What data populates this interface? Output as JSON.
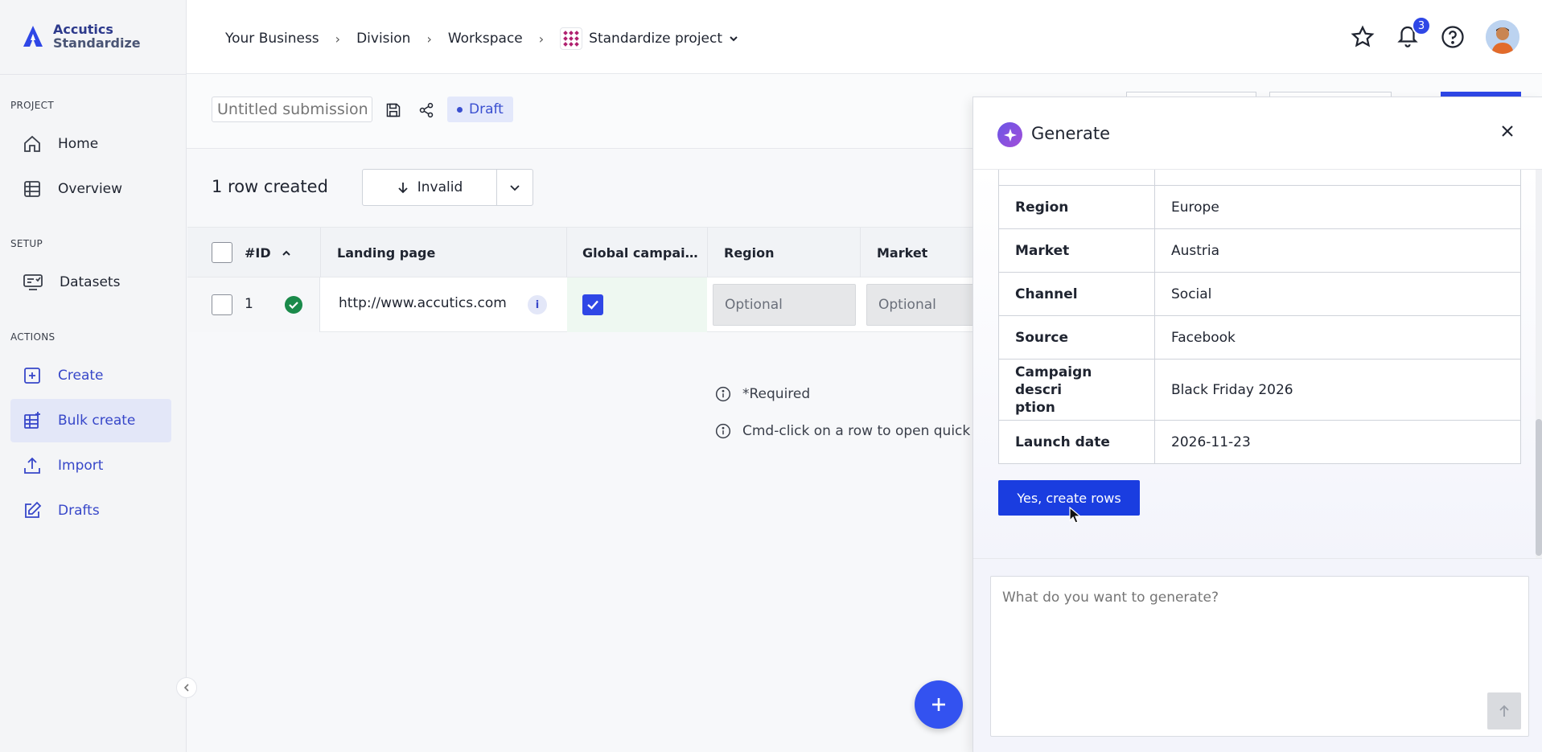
{
  "app": {
    "logo_line1": "Accutics",
    "logo_line2": "Standardize"
  },
  "breadcrumb": [
    "Your Business",
    "Division",
    "Workspace",
    "Standardize project"
  ],
  "notifications": {
    "count": "3"
  },
  "sidebar": {
    "sections": [
      {
        "label": "PROJECT",
        "items": [
          {
            "label": "Home",
            "icon": "home-icon"
          },
          {
            "label": "Overview",
            "icon": "table-icon"
          }
        ]
      },
      {
        "label": "SETUP",
        "items": [
          {
            "label": "Datasets",
            "icon": "datasets-icon"
          }
        ]
      },
      {
        "label": "ACTIONS",
        "items": [
          {
            "label": "Create",
            "icon": "plus-square-icon"
          },
          {
            "label": "Bulk create",
            "icon": "bulk-create-icon",
            "active": true
          },
          {
            "label": "Import",
            "icon": "upload-icon"
          },
          {
            "label": "Drafts",
            "icon": "edit-icon"
          }
        ]
      }
    ]
  },
  "submission": {
    "title_placeholder": "Untitled submission",
    "status": "Draft"
  },
  "rows": {
    "summary": "1 row created",
    "filter_label": "Invalid"
  },
  "table": {
    "columns": [
      "#ID",
      "Landing page",
      "Global campai…",
      "Region",
      "Market"
    ],
    "row": {
      "id": "1",
      "landing_page": "http://www.accutics.com",
      "global_campaign_checked": true,
      "region": "Optional",
      "market": "Optional"
    }
  },
  "notes": {
    "required": "*Required",
    "cmd_click": "Cmd-click on a row to open quick a"
  },
  "generate_panel": {
    "title": "Generate",
    "fields": [
      {
        "key": "Region",
        "value": "Europe"
      },
      {
        "key": "Market",
        "value": "Austria"
      },
      {
        "key": "Channel",
        "value": "Social"
      },
      {
        "key": "Source",
        "value": "Facebook"
      },
      {
        "key": "Campaign description",
        "key_display": "Campaign descri\nption",
        "value": "Black Friday 2026"
      },
      {
        "key": "Launch date",
        "value": "2026-11-23"
      }
    ],
    "confirm_button": "Yes, create rows",
    "prompt_placeholder": "What do you want to generate?"
  },
  "colors": {
    "accent": "#2f47e6",
    "button_primary": "#1a3de0",
    "sidebar_active_bg": "#e3e7f8",
    "success": "#1a8a4a"
  }
}
